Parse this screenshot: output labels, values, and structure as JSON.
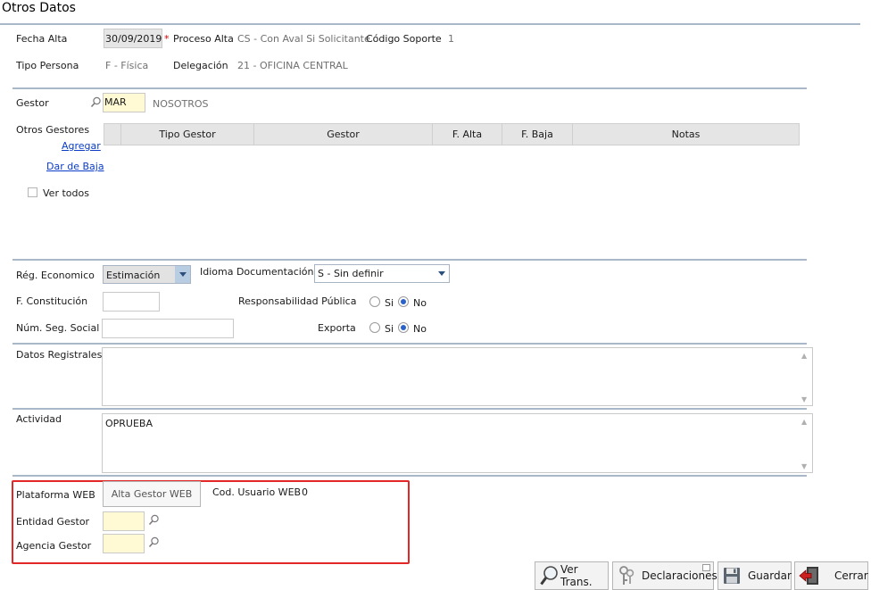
{
  "window": {
    "title": "Otros Datos"
  },
  "header": {
    "fecha_alta_label": "Fecha Alta",
    "fecha_alta_value": "30/09/2019",
    "required_mark": "*",
    "proceso_alta_label": "Proceso Alta",
    "proceso_alta_value": "CS - Con Aval Si Solicitante",
    "codigo_soporte_label": "Código Soporte",
    "codigo_soporte_value": "1",
    "tipo_persona_label": "Tipo Persona",
    "tipo_persona_value": "F - Física",
    "delegacion_label": "Delegación",
    "delegacion_value": "21 - OFICINA CENTRAL"
  },
  "gestor": {
    "label": "Gestor",
    "code": "MAR",
    "name": "NOSOTROS",
    "otros_label": "Otros Gestores",
    "agregar": "Agregar",
    "dar_de_baja": "Dar de Baja",
    "ver_todos": "Ver todos",
    "columns": [
      "",
      "Tipo Gestor",
      "Gestor",
      "F. Alta",
      "F. Baja",
      "Notas"
    ]
  },
  "economico": {
    "reg_label": "Rég. Economico",
    "reg_value": "Estimación",
    "idioma_label": "Idioma Documentación",
    "idioma_value": "S - Sin definir",
    "f_constitucion_label": "F. Constitución",
    "f_constitucion_value": "",
    "resp_publica_label": "Responsabilidad Pública",
    "num_seg_social_label": "Núm. Seg. Social",
    "num_seg_social_value": "",
    "exporta_label": "Exporta",
    "si": "Si",
    "no": "No"
  },
  "datos_registrales": {
    "label": "Datos Registrales",
    "value": ""
  },
  "actividad": {
    "label": "Actividad",
    "value": "OPRUEBA"
  },
  "web": {
    "plataforma_label": "Plataforma WEB",
    "alta_gestor_btn": "Alta Gestor WEB",
    "cod_usuario_label": "Cod. Usuario WEB",
    "cod_usuario_value": "0",
    "entidad_label": "Entidad Gestor",
    "entidad_value": "",
    "agencia_label": "Agencia Gestor",
    "agencia_value": ""
  },
  "footer": {
    "ver_trans": "Ver Trans.",
    "declaraciones": "Declaraciones",
    "guardar": "Guardar",
    "cerrar": "Cerrar"
  },
  "colors": {
    "accent": "#0a3cc8",
    "highlight_box": "#e32626",
    "field_yellow": "#fff9d4",
    "rule": "#a9b8c8"
  }
}
